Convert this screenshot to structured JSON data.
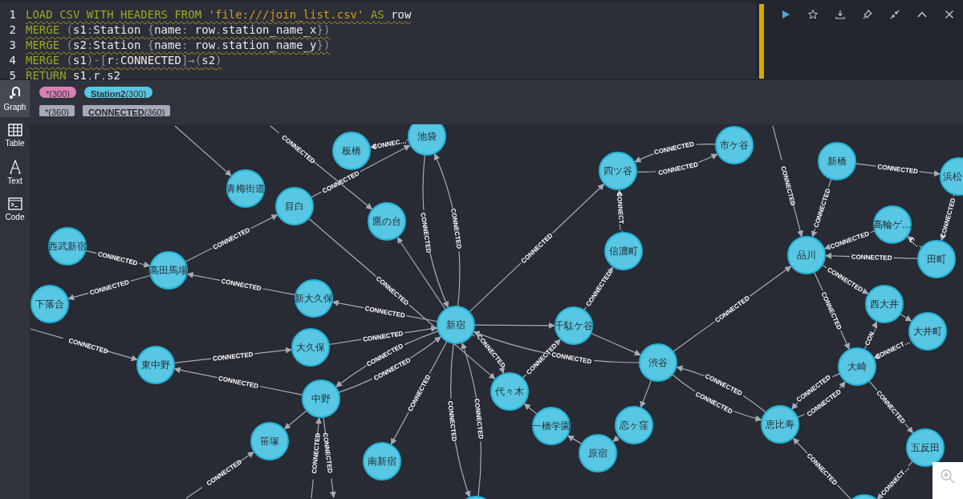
{
  "editor": {
    "lines": [
      {
        "number": "1",
        "tokens": [
          {
            "text": "LOAD CSV WITH HEADERS FROM",
            "kind": "keyword"
          },
          {
            "text": " 'file:///join_list.csv'",
            "kind": "string"
          },
          {
            "text": " AS",
            "kind": "keyword"
          },
          {
            "text": " row",
            "kind": "plain"
          }
        ]
      },
      {
        "number": "2",
        "tokens": [
          {
            "text": "MERGE",
            "kind": "keyword"
          },
          {
            "text": " (",
            "kind": "punct"
          },
          {
            "text": "s1",
            "kind": "plain"
          },
          {
            "text": ":",
            "kind": "punct"
          },
          {
            "text": "Station ",
            "kind": "plain"
          },
          {
            "text": "{",
            "kind": "punct"
          },
          {
            "text": "name",
            "kind": "plain"
          },
          {
            "text": ":",
            "kind": "punct"
          },
          {
            "text": " row",
            "kind": "plain"
          },
          {
            "text": ".",
            "kind": "punct"
          },
          {
            "text": "station_name_x",
            "kind": "plain"
          },
          {
            "text": "})",
            "kind": "punct"
          }
        ]
      },
      {
        "number": "3",
        "tokens": [
          {
            "text": "MERGE",
            "kind": "keyword"
          },
          {
            "text": " (",
            "kind": "punct"
          },
          {
            "text": "s2",
            "kind": "plain"
          },
          {
            "text": ":",
            "kind": "punct"
          },
          {
            "text": "Station ",
            "kind": "plain"
          },
          {
            "text": "{",
            "kind": "punct"
          },
          {
            "text": "name",
            "kind": "plain"
          },
          {
            "text": ":",
            "kind": "punct"
          },
          {
            "text": " row",
            "kind": "plain"
          },
          {
            "text": ".",
            "kind": "punct"
          },
          {
            "text": "station_name_y",
            "kind": "plain"
          },
          {
            "text": "})",
            "kind": "punct"
          }
        ]
      },
      {
        "number": "4",
        "tokens": [
          {
            "text": "MERGE",
            "kind": "keyword"
          },
          {
            "text": " (",
            "kind": "punct"
          },
          {
            "text": "s1",
            "kind": "plain"
          },
          {
            "text": ")-[",
            "kind": "punct"
          },
          {
            "text": "r",
            "kind": "plain"
          },
          {
            "text": ":",
            "kind": "punct"
          },
          {
            "text": "CONNECTED",
            "kind": "plain"
          },
          {
            "text": "]→(",
            "kind": "punct"
          },
          {
            "text": "s2",
            "kind": "plain"
          },
          {
            "text": ")",
            "kind": "punct"
          }
        ]
      },
      {
        "number": "5",
        "tokens": [
          {
            "text": "RETURN",
            "kind": "keyword"
          },
          {
            "text": " s1",
            "kind": "plain"
          },
          {
            "text": ",",
            "kind": "punct"
          },
          {
            "text": "r",
            "kind": "plain"
          },
          {
            "text": ",",
            "kind": "punct"
          },
          {
            "text": "s2",
            "kind": "plain"
          }
        ]
      }
    ]
  },
  "sidebar": {
    "items": [
      {
        "label": "Graph",
        "selected": true
      },
      {
        "label": "Table",
        "selected": false
      },
      {
        "label": "Text",
        "selected": false
      },
      {
        "label": "Code",
        "selected": false
      }
    ]
  },
  "legend": {
    "node_labels": [
      {
        "text": "*(300)",
        "color": "#da7fb6"
      },
      {
        "text": "**Station2**(300)",
        "color": "#57c7e3"
      }
    ],
    "relationship_types": [
      {
        "text": "*(360)",
        "color": "#a5abb6"
      },
      {
        "text": "**CONNECTED**(360)",
        "color": "#a5abb6"
      }
    ]
  },
  "graph": {
    "nodes": [
      {
        "kind": "station",
        "name": "池袋"
      },
      {
        "kind": "station",
        "name": "板橋"
      },
      {
        "kind": "station",
        "name": "青梅街道"
      },
      {
        "kind": "station",
        "name": "目白"
      },
      {
        "kind": "station",
        "name": "鷹の台"
      },
      {
        "kind": "station",
        "name": "西武新宿"
      },
      {
        "kind": "station",
        "name": "高田馬場"
      },
      {
        "kind": "station",
        "name": "下落合"
      },
      {
        "kind": "station",
        "name": "新大久保"
      },
      {
        "kind": "station",
        "name": "新宿"
      },
      {
        "kind": "station",
        "name": "大久保"
      },
      {
        "kind": "station",
        "name": "東中野"
      },
      {
        "kind": "station",
        "name": "中野"
      },
      {
        "kind": "station",
        "name": "笹塚"
      },
      {
        "kind": "station",
        "name": "南新宿"
      },
      {
        "kind": "station",
        "name": "四ツ谷"
      },
      {
        "kind": "station",
        "name": "市ケ谷"
      },
      {
        "kind": "station",
        "name": "新橋"
      },
      {
        "kind": "station",
        "name": "浜松"
      },
      {
        "kind": "station",
        "name": "信濃町"
      },
      {
        "kind": "station",
        "name": "品川"
      },
      {
        "kind": "station",
        "name": "高輪ゲ…"
      },
      {
        "kind": "station",
        "name": "田町"
      },
      {
        "kind": "station",
        "name": "千駄ケ谷"
      },
      {
        "kind": "station",
        "name": "渋谷"
      },
      {
        "kind": "station",
        "name": "西大井"
      },
      {
        "kind": "station",
        "name": "大井町"
      },
      {
        "kind": "station",
        "name": "大崎"
      },
      {
        "kind": "station",
        "name": "代々木"
      },
      {
        "kind": "station",
        "name": "一橋学園"
      },
      {
        "kind": "station",
        "name": "恋ヶ窪"
      },
      {
        "kind": "station",
        "name": "原宿"
      },
      {
        "kind": "station",
        "name": "恵比寿"
      },
      {
        "kind": "station",
        "name": "五反田"
      },
      {
        "kind": "partial"
      },
      {
        "kind": "partial"
      }
    ],
    "edges": [
      {
        "kind": "labeled",
        "label": "CONNEC…"
      },
      {
        "kind": "labeled",
        "label": "CONNECTED"
      },
      {
        "kind": "labeled",
        "label": "CONNECTED"
      },
      {
        "kind": "labeled",
        "label": "CONNECTED"
      },
      {
        "kind": "labeled",
        "label": "CONNECTED"
      },
      {
        "kind": "labeled",
        "label": "CONNECTED"
      },
      {
        "kind": "labeled",
        "label": "CONNECTED"
      },
      {
        "kind": "labeled",
        "label": "CONNECTED"
      },
      {
        "kind": "labeled",
        "label": "CONNECTED"
      },
      {
        "kind": "labeled",
        "label": "CONNECTED"
      },
      {
        "kind": "labeled",
        "label": "CONNECTED"
      },
      {
        "kind": "labeled",
        "label": "CONNECTED"
      },
      {
        "kind": "labeled",
        "label": "CONNECTED"
      },
      {
        "kind": "labeled",
        "label": "CONNECTED"
      },
      {
        "kind": "labeled",
        "label": "CONNECTED"
      },
      {
        "kind": "unlabeled"
      },
      {
        "kind": "labeled",
        "label": "CONNECTED"
      },
      {
        "kind": "labeled",
        "label": "CONNECTED"
      },
      {
        "kind": "labeled",
        "label": "CONNECTED"
      },
      {
        "kind": "labeled",
        "label": "CONNECTED"
      },
      {
        "kind": "unlabeled"
      },
      {
        "kind": "labeled",
        "label": "CONNECTED"
      },
      {
        "kind": "unlabeled"
      },
      {
        "kind": "labeled",
        "label": "CONNECTED"
      },
      {
        "kind": "labeled",
        "label": "CONNECT…"
      },
      {
        "kind": "labeled",
        "label": "CONNECTED"
      },
      {
        "kind": "labeled",
        "label": "CONNECTED"
      },
      {
        "kind": "labeled",
        "label": "CONNECTED"
      },
      {
        "kind": "unlabeled"
      },
      {
        "kind": "labeled",
        "label": "CONNECTED"
      },
      {
        "kind": "labeled",
        "label": "CONNECTED"
      },
      {
        "kind": "labeled",
        "label": "CONNECTED"
      },
      {
        "kind": "labeled",
        "label": "CONNECTED"
      },
      {
        "kind": "labeled",
        "label": "CONNECTED"
      },
      {
        "kind": "labeled",
        "label": "CONNECTED"
      },
      {
        "kind": "labeled",
        "label": "CONNECTED"
      },
      {
        "kind": "labeled",
        "label": "CONNECTED"
      },
      {
        "kind": "labeled",
        "label": "CONNECTED"
      },
      {
        "kind": "labeled",
        "label": "CONNECTED"
      },
      {
        "kind": "labeled",
        "label": "CONNECTED"
      },
      {
        "kind": "labeled",
        "label": "CONNECTED"
      },
      {
        "kind": "labeled",
        "label": "CONNECTED"
      },
      {
        "kind": "labeled",
        "label": "C…"
      },
      {
        "kind": "labeled",
        "label": "CONNECTED"
      },
      {
        "kind": "unlabeled"
      },
      {
        "kind": "labeled",
        "label": "CON…"
      },
      {
        "kind": "labeled",
        "label": "CONNECT…"
      },
      {
        "kind": "labeled",
        "label": "CONNECTED"
      },
      {
        "kind": "labeled",
        "label": "CONNECT…"
      },
      {
        "kind": "unlabeled"
      },
      {
        "kind": "unlabeled"
      },
      {
        "kind": "unlabeled"
      },
      {
        "kind": "unlabeled"
      },
      {
        "kind": "labeled",
        "label": "CONNECTED"
      },
      {
        "kind": "labeled",
        "label": "CONNECTED"
      },
      {
        "kind": "labeled",
        "label": "CONNECTED"
      },
      {
        "kind": "labeled",
        "label": "CONNECTED"
      },
      {
        "kind": "labeled",
        "label": "CONNECTED"
      },
      {
        "kind": "unlabeled"
      },
      {
        "kind": "labeled",
        "label": "CONNECTED"
      }
    ]
  }
}
